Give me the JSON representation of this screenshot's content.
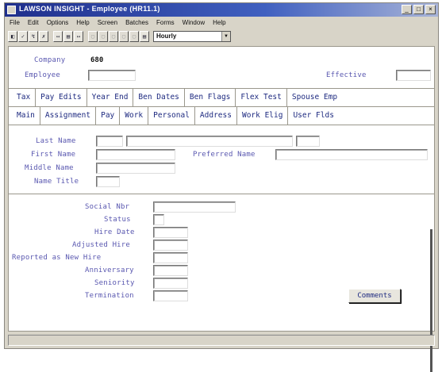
{
  "window": {
    "title": "LAWSON INSIGHT - Employee (HR11.1)"
  },
  "menu": [
    "File",
    "Edit",
    "Options",
    "Help",
    "Screen",
    "Batches",
    "Forms",
    "Window",
    "Help"
  ],
  "toolbar": {
    "buttons": [
      "◧",
      "✓",
      "↯",
      "✗",
      "↤",
      "▤",
      "↦",
      "▢",
      "▢",
      "▢",
      "▢",
      "▢",
      "▤"
    ],
    "select_value": "Hourly"
  },
  "header": {
    "company_label": "Company",
    "company_value": "680",
    "employee_label": "Employee",
    "effective_label": "Effective"
  },
  "tabs_row1": [
    "Tax",
    "Pay Edits",
    "Year End",
    "Ben Dates",
    "Ben Flags",
    "Flex Test",
    "Spouse Emp"
  ],
  "tabs_row2": [
    "Main",
    "Assignment",
    "Pay",
    "Work",
    "Personal",
    "Address",
    "Work Elig",
    "User Flds"
  ],
  "name_section": {
    "last_name_label": "Last Name",
    "first_name_label": "First Name",
    "preferred_name_label": "Preferred Name",
    "middle_name_label": "Middle Name",
    "name_title_label": "Name Title"
  },
  "dates_section": {
    "social_nbr_label": "Social Nbr",
    "status_label": "Status",
    "hire_date_label": "Hire Date",
    "adjusted_hire_label": "Adjusted Hire",
    "reported_new_hire_label": "Reported as New Hire",
    "anniversary_label": "Anniversary",
    "seniority_label": "Seniority",
    "termination_label": "Termination"
  },
  "comments_button": "Comments"
}
